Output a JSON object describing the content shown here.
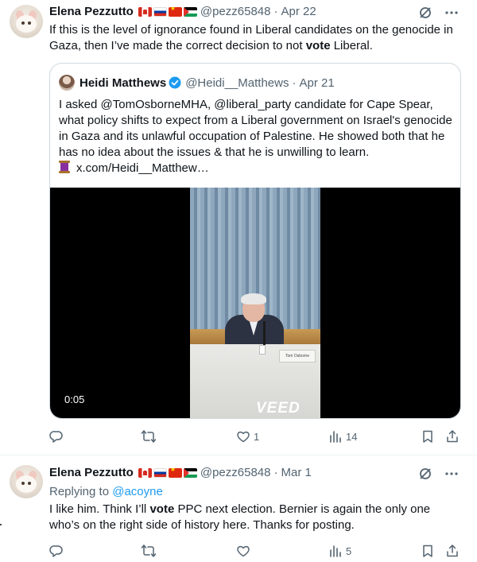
{
  "tweet1": {
    "author": "Elena Pezzutto",
    "handle": "@pezz65848",
    "separator": "·",
    "date": "Apr 22",
    "text_before": "If this is the level of ignorance found in Liberal candidates on the genocide in Gaza, then I’ve made the correct decision to not ",
    "text_bold": "vote",
    "text_after": " Liberal.",
    "quote": {
      "author": "Heidi Matthews",
      "handle": "@Heidi__Matthews",
      "separator": "·",
      "date": "Apr 21",
      "text": "I asked @TomOsborneMHA, @liberal_party candidate for Cape Spear, what policy shifts to expect from a Liberal government on Israel's genocide in Gaza and its unlawful occupation of Palestine. He showed both that he has no idea about the issues & that he is unwilling to learn.",
      "link": "x.com/Heidi__Matthew…",
      "video": {
        "timecode": "0:05",
        "watermark": "VEED",
        "nameplate": "Tom Osborne"
      }
    },
    "actions": {
      "reply": "",
      "repost": "",
      "like": "1",
      "views": "14"
    }
  },
  "tweet2": {
    "author": "Elena Pezzutto",
    "handle": "@pezz65848",
    "separator": "·",
    "date": "Mar 1",
    "replying_prefix": "Replying to",
    "replying_to": "@acoyne",
    "text_before": "I like him. Think I’ll ",
    "text_bold": "vote",
    "text_after": " PPC next election. Bernier is again the only one who’s on the right side of history here. Thanks for posting.",
    "actions": {
      "reply": "",
      "repost": "",
      "like": "",
      "views": "5"
    }
  },
  "icons": {
    "grok": "grok-icon",
    "more": "more-icon",
    "reply": "reply-icon",
    "repost": "repost-icon",
    "like": "heart-icon",
    "views": "views-icon",
    "bookmark": "bookmark-icon",
    "share": "share-icon",
    "verified": "verified-badge-icon"
  },
  "colors": {
    "text": "#0f1419",
    "secondary": "#536471",
    "link": "#1d9bf0",
    "border": "#cfd9de"
  }
}
